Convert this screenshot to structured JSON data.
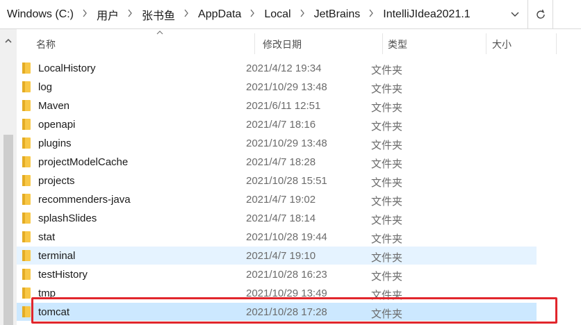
{
  "address_bar": {
    "crumbs": [
      "Windows (C:)",
      "用户",
      "张书鱼",
      "AppData",
      "Local",
      "JetBrains",
      "IntelliJIdea2021.1"
    ]
  },
  "columns": {
    "name": "名称",
    "modified": "修改日期",
    "type": "类型",
    "size": "大小"
  },
  "files": [
    {
      "name": "LocalHistory",
      "modified": "2021/4/12 19:34",
      "type": "文件夹"
    },
    {
      "name": "log",
      "modified": "2021/10/29 13:48",
      "type": "文件夹"
    },
    {
      "name": "Maven",
      "modified": "2021/6/11 12:51",
      "type": "文件夹"
    },
    {
      "name": "openapi",
      "modified": "2021/4/7 18:16",
      "type": "文件夹"
    },
    {
      "name": "plugins",
      "modified": "2021/10/29 13:48",
      "type": "文件夹"
    },
    {
      "name": "projectModelCache",
      "modified": "2021/4/7 18:28",
      "type": "文件夹"
    },
    {
      "name": "projects",
      "modified": "2021/10/28 15:51",
      "type": "文件夹"
    },
    {
      "name": "recommenders-java",
      "modified": "2021/4/7 19:02",
      "type": "文件夹"
    },
    {
      "name": "splashSlides",
      "modified": "2021/4/7 18:14",
      "type": "文件夹"
    },
    {
      "name": "stat",
      "modified": "2021/10/28 19:44",
      "type": "文件夹"
    },
    {
      "name": "terminal",
      "modified": "2021/4/7 19:10",
      "type": "文件夹",
      "state": "hover"
    },
    {
      "name": "testHistory",
      "modified": "2021/10/28 16:23",
      "type": "文件夹"
    },
    {
      "name": "tmp",
      "modified": "2021/10/29 13:49",
      "type": "文件夹"
    },
    {
      "name": "tomcat",
      "modified": "2021/10/28 17:28",
      "type": "文件夹",
      "state": "selected",
      "annotated": true
    }
  ],
  "icons": {
    "folder": "folder-icon",
    "refresh": "refresh-icon",
    "dropdown": "chevron-down-icon",
    "separator": "chevron-right-icon",
    "sort": "sort-ascending-icon"
  },
  "colors": {
    "hover_row": "#e5f3ff",
    "selected_row": "#cce8ff",
    "annotation": "#e1262c",
    "folder": "#f8c746"
  }
}
